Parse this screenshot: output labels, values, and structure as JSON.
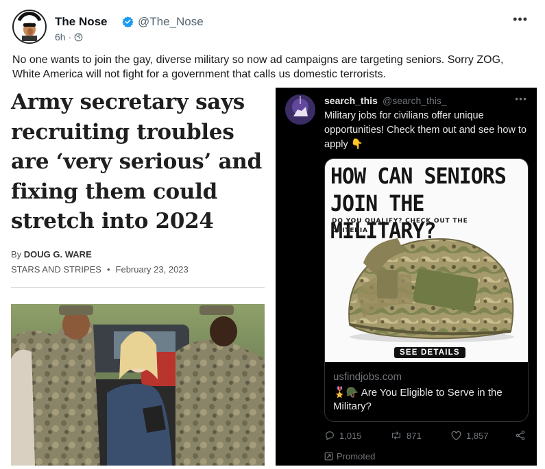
{
  "post": {
    "author": "The Nose",
    "handle": "@The_Nose",
    "time": "6h",
    "text": "No one wants to join the gay, diverse military so now ad campaigns are targeting seniors. Sorry ZOG, White America will not fight for a government that calls us domestic terrorists.",
    "avatar_text": "THE NOSE KNOWS"
  },
  "article": {
    "title": "Army secretary says recruiting troubles are ‘very serious’ and fixing them could stretch into 2024",
    "byline_prefix": "By",
    "author": "DOUG G. WARE",
    "source": "STARS AND STRIPES",
    "bullet": "•",
    "date": "February 23, 2023"
  },
  "embed": {
    "name": "search_this",
    "handle": "@search_this_",
    "text": "Military jobs for civilians offer unique opportunities! Check them out and see how to apply 👇",
    "card": {
      "headline": "HOW CAN SENIORS JOIN THE MILITARY?",
      "subtext": "DO YOU QUALIFY? CHECK OUT THE CRITERIA",
      "button": "SEE DETAILS",
      "domain": "usfindjobs.com",
      "title": "🎖️🪖 Are You Eligible to Serve in the Military?"
    },
    "stats": {
      "replies": "1,015",
      "reposts": "871",
      "likes": "1,857"
    },
    "promoted": "Promoted"
  },
  "colors": {
    "verified": "#1d9bf0",
    "embed_bg": "#000000",
    "muted": "#71767b"
  }
}
